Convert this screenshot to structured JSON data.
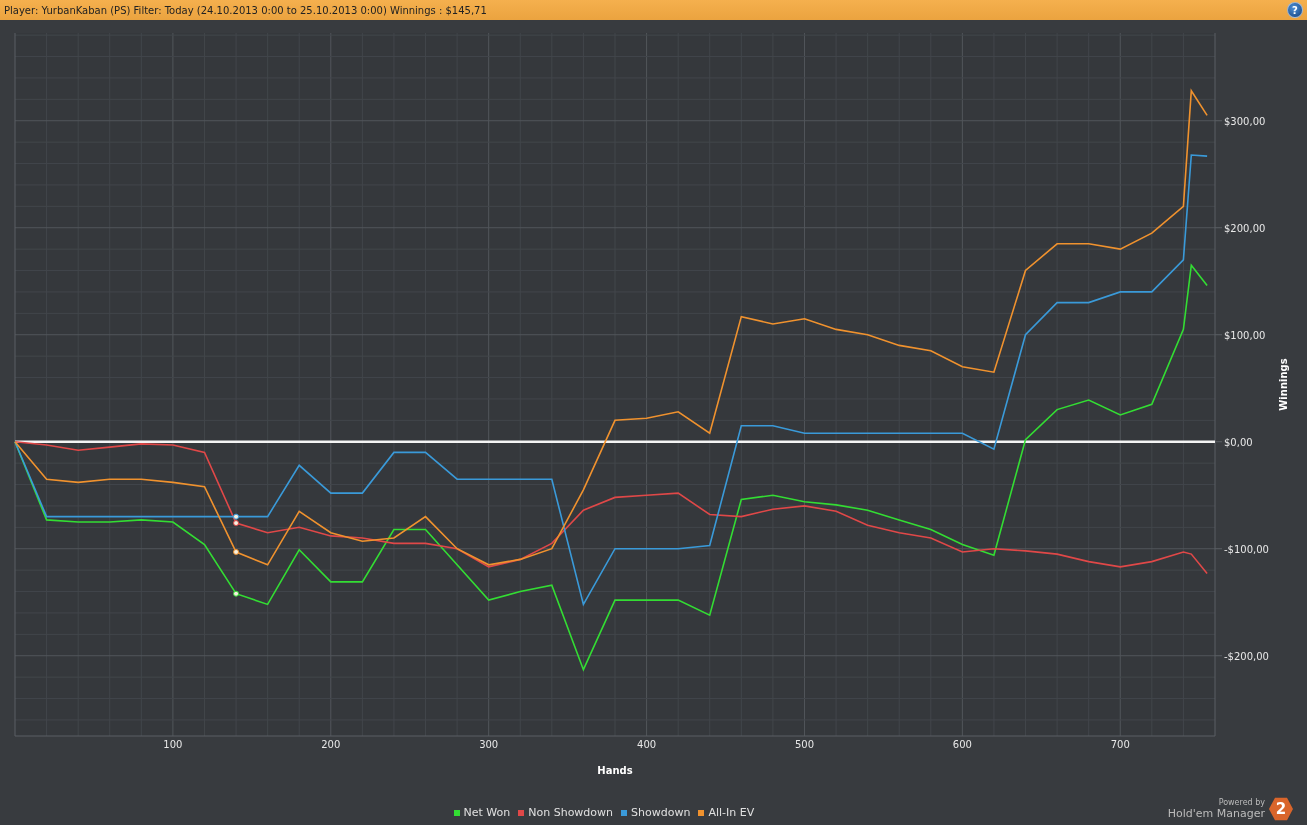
{
  "header": {
    "title": "Player: YurbanKaban (PS) Filter: Today (24.10.2013 0:00 to 25.10.2013 0:00) Winnings : $145,71",
    "help_button": "?"
  },
  "chart": {
    "chart_data": {
      "type": "line",
      "grid": true,
      "xlabel": "Hands",
      "ylabel": "Winnings",
      "x": [
        0,
        20,
        40,
        60,
        80,
        100,
        120,
        140,
        160,
        180,
        200,
        220,
        240,
        260,
        280,
        300,
        320,
        340,
        360,
        380,
        400,
        420,
        440,
        460,
        480,
        500,
        520,
        540,
        560,
        580,
        600,
        620,
        640,
        660,
        680,
        700,
        720,
        740,
        745,
        755
      ],
      "series": [
        {
          "name": "Net Won",
          "color": "#33dd33",
          "values": [
            0,
            -73,
            -75,
            -75,
            -73,
            -75,
            -96,
            -142,
            -152,
            -101,
            -131,
            -131,
            -82,
            -82,
            -115,
            -148,
            -140,
            -134,
            -213,
            -148,
            -148,
            -148,
            -162,
            -54,
            -50,
            -56,
            -59,
            -64,
            -73,
            -82,
            -96,
            -106,
            2,
            30,
            39,
            25,
            35,
            105,
            165,
            146
          ]
        },
        {
          "name": "Non Showdown",
          "color": "#e04848",
          "values": [
            0,
            -3,
            -8,
            -5,
            -2,
            -3,
            -10,
            -76,
            -85,
            -80,
            -88,
            -90,
            -95,
            -95,
            -100,
            -117,
            -110,
            -95,
            -64,
            -52,
            -50,
            -48,
            -68,
            -70,
            -63,
            -60,
            -65,
            -78,
            -85,
            -90,
            -103,
            -100,
            -102,
            -105,
            -112,
            -117,
            -112,
            -103,
            -105,
            -123
          ]
        },
        {
          "name": "Showdown",
          "color": "#3a9ad9",
          "values": [
            0,
            -70,
            -70,
            -70,
            -70,
            -70,
            -70,
            -70,
            -70,
            -22,
            -48,
            -48,
            -10,
            -10,
            -35,
            -35,
            -35,
            -35,
            -152,
            -100,
            -100,
            -100,
            -97,
            15,
            15,
            8,
            8,
            8,
            8,
            8,
            8,
            -7,
            100,
            130,
            130,
            140,
            140,
            170,
            268,
            267
          ]
        },
        {
          "name": "All-In EV",
          "color": "#f0922e",
          "values": [
            0,
            -35,
            -38,
            -35,
            -35,
            -38,
            -42,
            -103,
            -115,
            -65,
            -85,
            -93,
            -90,
            -70,
            -100,
            -115,
            -110,
            -100,
            -45,
            20,
            22,
            28,
            8,
            117,
            110,
            115,
            105,
            100,
            90,
            85,
            70,
            65,
            160,
            185,
            185,
            180,
            195,
            220,
            328,
            305
          ]
        }
      ],
      "xlim": [
        0,
        760
      ],
      "ylim": [
        -275,
        382
      ],
      "xticks": [
        100,
        200,
        300,
        400,
        500,
        600,
        700
      ],
      "yticks": [
        {
          "value": -200,
          "label": "-$200,00"
        },
        {
          "value": -100,
          "label": "-$100,00"
        },
        {
          "value": 0,
          "label": "$0,00"
        },
        {
          "value": 100,
          "label": "$100,00"
        },
        {
          "value": 200,
          "label": "$200,00"
        },
        {
          "value": 300,
          "label": "$300,00"
        }
      ]
    }
  },
  "footer": {
    "powered_by": "Powered by",
    "product": "Hold'em Manager",
    "logo_number": "2"
  }
}
